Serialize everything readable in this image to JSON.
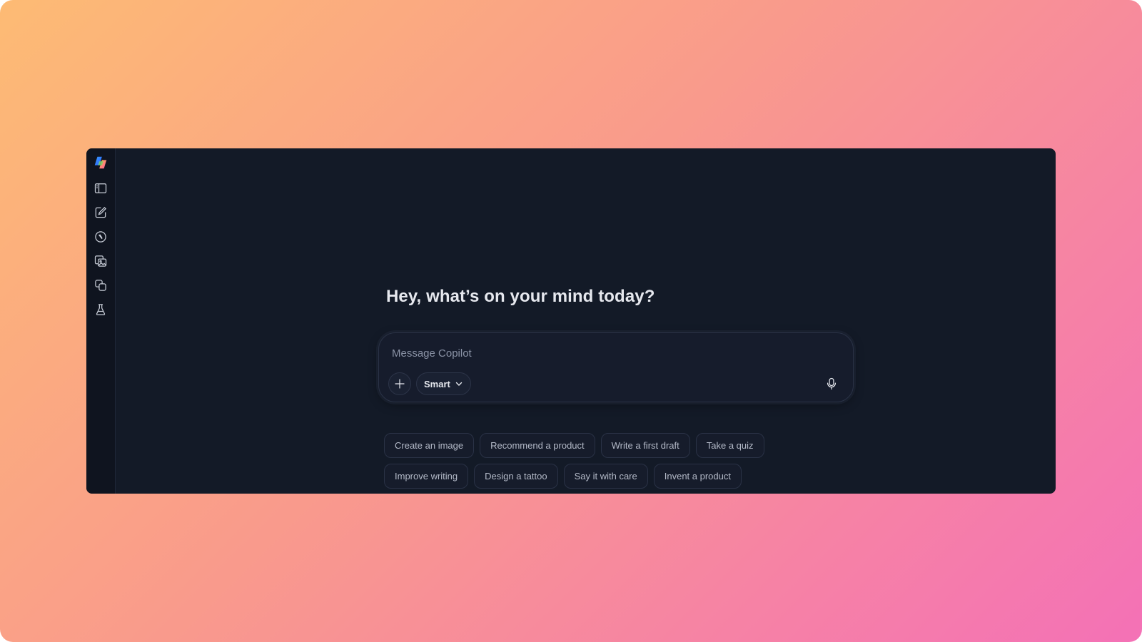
{
  "app": {
    "greeting": "Hey, what’s on your mind today?"
  },
  "sidebar": {
    "items": [
      {
        "name": "copilot-logo-icon"
      },
      {
        "name": "sidebar-toggle-icon"
      },
      {
        "name": "new-chat-icon"
      },
      {
        "name": "discover-icon"
      },
      {
        "name": "images-icon"
      },
      {
        "name": "pages-icon"
      },
      {
        "name": "labs-icon"
      }
    ]
  },
  "composer": {
    "placeholder": "Message Copilot",
    "value": "",
    "mode_label": "Smart"
  },
  "suggestions": {
    "row1": [
      "Create an image",
      "Recommend a product",
      "Write a first draft",
      "Take a quiz"
    ],
    "row2": [
      "Improve writing",
      "Design a tattoo",
      "Say it with care",
      "Invent a product"
    ]
  },
  "colors": {
    "window_bg": "#131a27",
    "sidebar_bg": "#0f141f",
    "text_primary": "#e6e8ee",
    "text_secondary": "#b4bac8"
  }
}
